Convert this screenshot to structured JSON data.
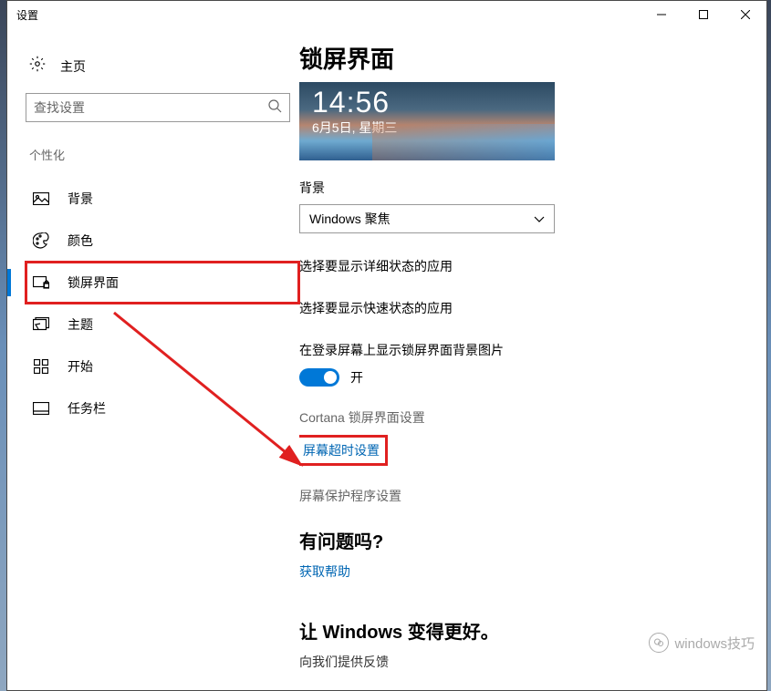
{
  "window": {
    "title": "设置"
  },
  "sidebar": {
    "home": "主页",
    "searchPlaceholder": "查找设置",
    "category": "个性化",
    "items": [
      {
        "label": "背景"
      },
      {
        "label": "颜色"
      },
      {
        "label": "锁屏界面"
      },
      {
        "label": "主题"
      },
      {
        "label": "开始"
      },
      {
        "label": "任务栏"
      }
    ]
  },
  "main": {
    "title": "锁屏界面",
    "preview": {
      "time": "14:56",
      "date": "6月5日, 星期三"
    },
    "backgroundLabel": "背景",
    "backgroundValue": "Windows 聚焦",
    "detailAppsLabel": "选择要显示详细状态的应用",
    "quickAppsLabel": "选择要显示快速状态的应用",
    "loginBgLabel": "在登录屏幕上显示锁屏界面背景图片",
    "toggleState": "开",
    "links": {
      "cortana": "Cortana 锁屏界面设置",
      "timeout": "屏幕超时设置",
      "screensaver": "屏幕保护程序设置"
    },
    "question": {
      "header": "有问题吗?",
      "help": "获取帮助"
    },
    "better": {
      "header": "让 Windows 变得更好。",
      "feedback": "向我们提供反馈"
    }
  },
  "watermark": "windows技巧"
}
